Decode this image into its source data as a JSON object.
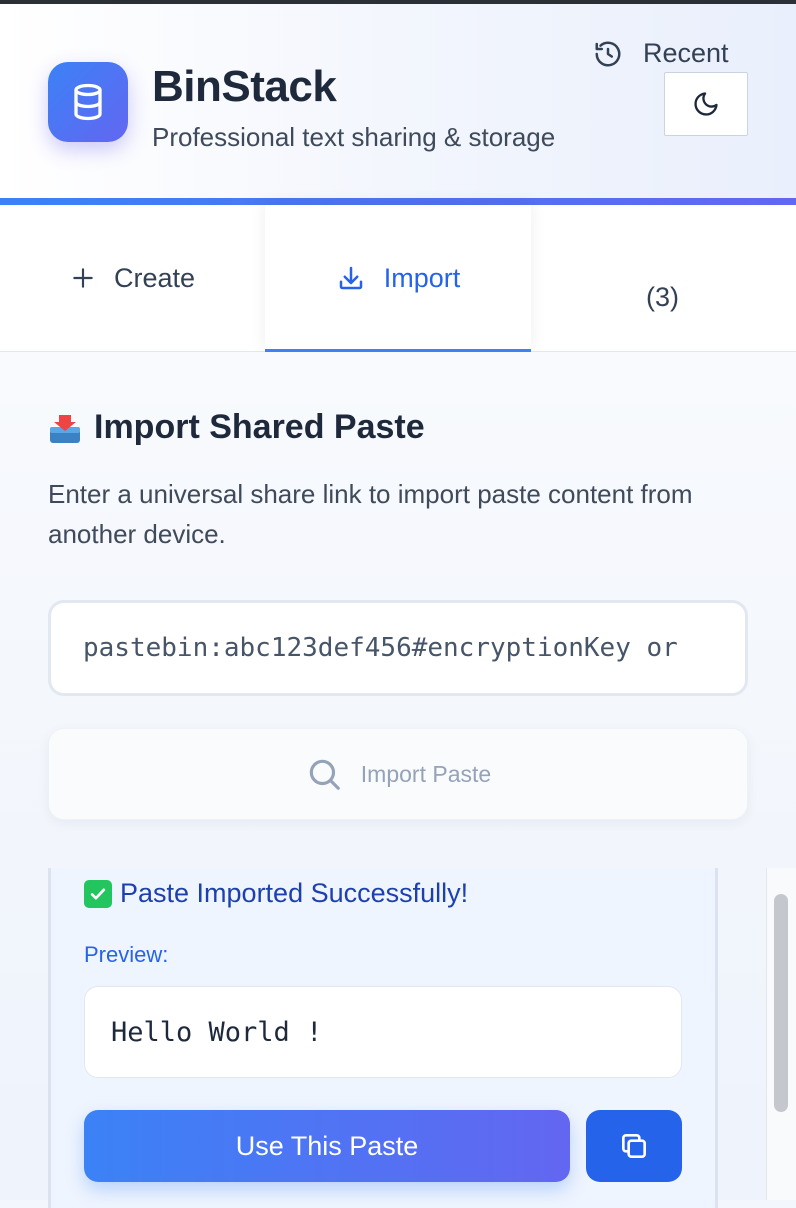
{
  "app": {
    "title": "BinStack",
    "subtitle": "Professional text sharing & storage",
    "logo_icon": "database-icon",
    "theme_toggle_icon": "moon-icon"
  },
  "tabs": [
    {
      "label": "Create",
      "icon": "plus-icon",
      "active": false
    },
    {
      "label": "Import",
      "icon": "download-icon",
      "active": true
    },
    {
      "label": "Recent",
      "count": "(3)",
      "icon": "history-icon",
      "active": false
    }
  ],
  "import": {
    "title": "Import Shared Paste",
    "title_icon": "inbox-tray-icon",
    "description": "Enter a universal share link to import paste content from another device.",
    "input_value": "pastebin:abc123def456#encryptionKey or",
    "button_label": "Import Paste",
    "button_icon": "search-icon"
  },
  "result": {
    "title": "Paste Imported Successfully!",
    "status_icon": "check-mark-icon",
    "preview_label": "Preview:",
    "preview_text": "Hello World !",
    "use_button_label": "Use This Paste",
    "copy_icon": "copy-icon"
  },
  "colors": {
    "accent": "#3b82f6",
    "accent_secondary": "#6366f1",
    "active_tab_text": "#2563eb",
    "success": "#22c55e"
  }
}
